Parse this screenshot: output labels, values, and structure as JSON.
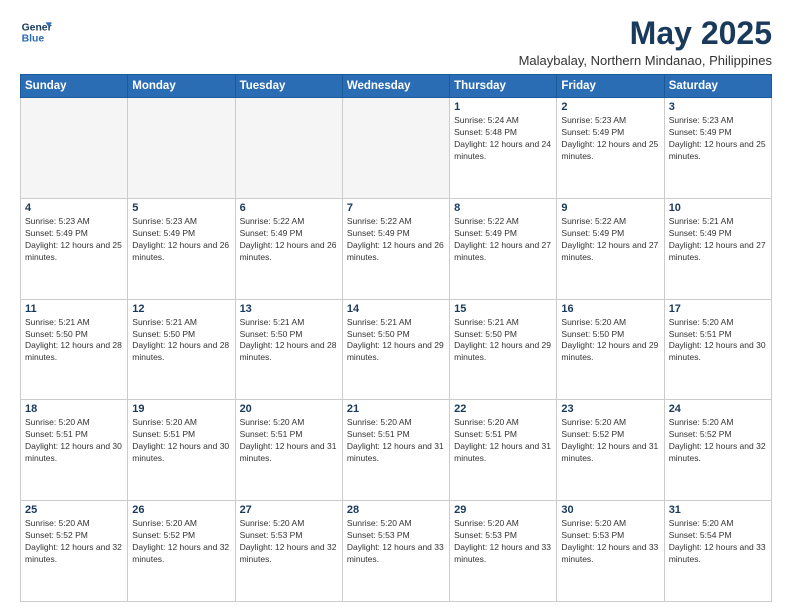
{
  "logo": {
    "line1": "General",
    "line2": "Blue"
  },
  "title": "May 2025",
  "subtitle": "Malaybalay, Northern Mindanao, Philippines",
  "weekdays": [
    "Sunday",
    "Monday",
    "Tuesday",
    "Wednesday",
    "Thursday",
    "Friday",
    "Saturday"
  ],
  "weeks": [
    [
      {
        "day": "",
        "empty": true
      },
      {
        "day": "",
        "empty": true
      },
      {
        "day": "",
        "empty": true
      },
      {
        "day": "",
        "empty": true
      },
      {
        "day": "1",
        "sunrise": "5:24 AM",
        "sunset": "5:48 PM",
        "daylight": "12 hours and 24 minutes."
      },
      {
        "day": "2",
        "sunrise": "5:23 AM",
        "sunset": "5:49 PM",
        "daylight": "12 hours and 25 minutes."
      },
      {
        "day": "3",
        "sunrise": "5:23 AM",
        "sunset": "5:49 PM",
        "daylight": "12 hours and 25 minutes."
      }
    ],
    [
      {
        "day": "4",
        "sunrise": "5:23 AM",
        "sunset": "5:49 PM",
        "daylight": "12 hours and 25 minutes."
      },
      {
        "day": "5",
        "sunrise": "5:23 AM",
        "sunset": "5:49 PM",
        "daylight": "12 hours and 26 minutes."
      },
      {
        "day": "6",
        "sunrise": "5:22 AM",
        "sunset": "5:49 PM",
        "daylight": "12 hours and 26 minutes."
      },
      {
        "day": "7",
        "sunrise": "5:22 AM",
        "sunset": "5:49 PM",
        "daylight": "12 hours and 26 minutes."
      },
      {
        "day": "8",
        "sunrise": "5:22 AM",
        "sunset": "5:49 PM",
        "daylight": "12 hours and 27 minutes."
      },
      {
        "day": "9",
        "sunrise": "5:22 AM",
        "sunset": "5:49 PM",
        "daylight": "12 hours and 27 minutes."
      },
      {
        "day": "10",
        "sunrise": "5:21 AM",
        "sunset": "5:49 PM",
        "daylight": "12 hours and 27 minutes."
      }
    ],
    [
      {
        "day": "11",
        "sunrise": "5:21 AM",
        "sunset": "5:50 PM",
        "daylight": "12 hours and 28 minutes."
      },
      {
        "day": "12",
        "sunrise": "5:21 AM",
        "sunset": "5:50 PM",
        "daylight": "12 hours and 28 minutes."
      },
      {
        "day": "13",
        "sunrise": "5:21 AM",
        "sunset": "5:50 PM",
        "daylight": "12 hours and 28 minutes."
      },
      {
        "day": "14",
        "sunrise": "5:21 AM",
        "sunset": "5:50 PM",
        "daylight": "12 hours and 29 minutes."
      },
      {
        "day": "15",
        "sunrise": "5:21 AM",
        "sunset": "5:50 PM",
        "daylight": "12 hours and 29 minutes."
      },
      {
        "day": "16",
        "sunrise": "5:20 AM",
        "sunset": "5:50 PM",
        "daylight": "12 hours and 29 minutes."
      },
      {
        "day": "17",
        "sunrise": "5:20 AM",
        "sunset": "5:51 PM",
        "daylight": "12 hours and 30 minutes."
      }
    ],
    [
      {
        "day": "18",
        "sunrise": "5:20 AM",
        "sunset": "5:51 PM",
        "daylight": "12 hours and 30 minutes."
      },
      {
        "day": "19",
        "sunrise": "5:20 AM",
        "sunset": "5:51 PM",
        "daylight": "12 hours and 30 minutes."
      },
      {
        "day": "20",
        "sunrise": "5:20 AM",
        "sunset": "5:51 PM",
        "daylight": "12 hours and 31 minutes."
      },
      {
        "day": "21",
        "sunrise": "5:20 AM",
        "sunset": "5:51 PM",
        "daylight": "12 hours and 31 minutes."
      },
      {
        "day": "22",
        "sunrise": "5:20 AM",
        "sunset": "5:51 PM",
        "daylight": "12 hours and 31 minutes."
      },
      {
        "day": "23",
        "sunrise": "5:20 AM",
        "sunset": "5:52 PM",
        "daylight": "12 hours and 31 minutes."
      },
      {
        "day": "24",
        "sunrise": "5:20 AM",
        "sunset": "5:52 PM",
        "daylight": "12 hours and 32 minutes."
      }
    ],
    [
      {
        "day": "25",
        "sunrise": "5:20 AM",
        "sunset": "5:52 PM",
        "daylight": "12 hours and 32 minutes."
      },
      {
        "day": "26",
        "sunrise": "5:20 AM",
        "sunset": "5:52 PM",
        "daylight": "12 hours and 32 minutes."
      },
      {
        "day": "27",
        "sunrise": "5:20 AM",
        "sunset": "5:53 PM",
        "daylight": "12 hours and 32 minutes."
      },
      {
        "day": "28",
        "sunrise": "5:20 AM",
        "sunset": "5:53 PM",
        "daylight": "12 hours and 33 minutes."
      },
      {
        "day": "29",
        "sunrise": "5:20 AM",
        "sunset": "5:53 PM",
        "daylight": "12 hours and 33 minutes."
      },
      {
        "day": "30",
        "sunrise": "5:20 AM",
        "sunset": "5:53 PM",
        "daylight": "12 hours and 33 minutes."
      },
      {
        "day": "31",
        "sunrise": "5:20 AM",
        "sunset": "5:54 PM",
        "daylight": "12 hours and 33 minutes."
      }
    ]
  ]
}
